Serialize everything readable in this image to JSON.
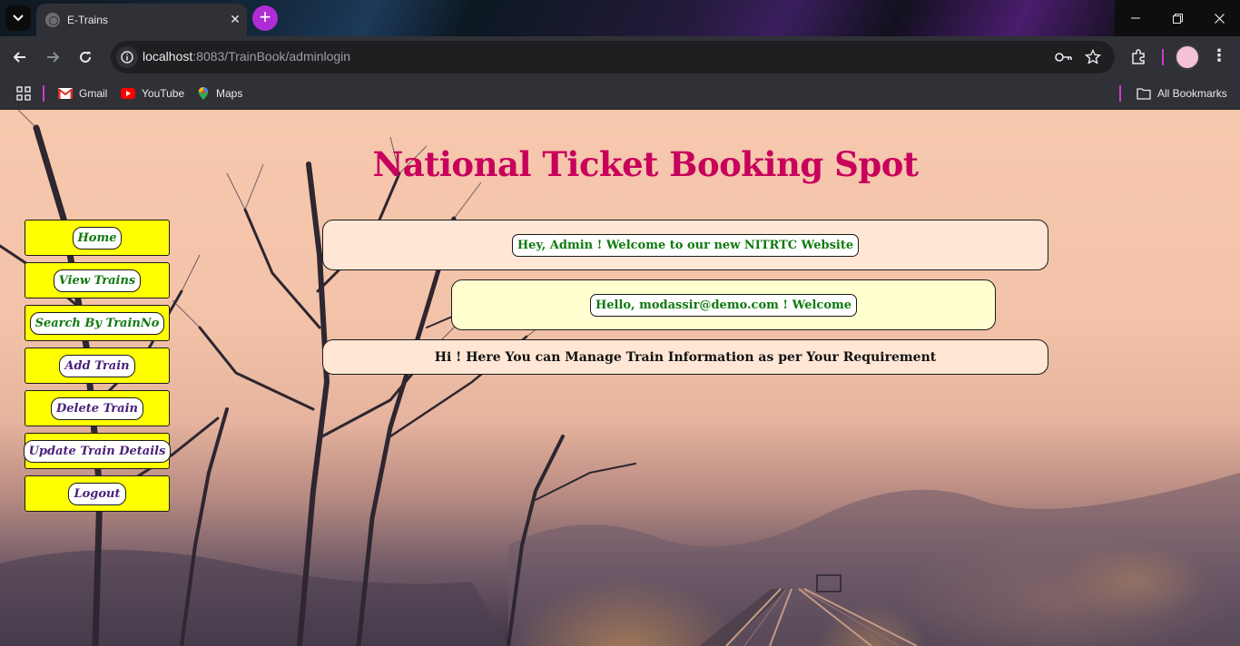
{
  "browser": {
    "tab_title": "E-Trains",
    "url_host": "localhost",
    "url_rest": ":8083/TrainBook/adminlogin",
    "bookmarks": [
      "Gmail",
      "YouTube",
      "Maps"
    ],
    "all_bookmarks": "All Bookmarks"
  },
  "page": {
    "title": "National Ticket Booking Spot",
    "nav": [
      {
        "label": "Home",
        "color": "#0f7a0f"
      },
      {
        "label": "View Trains",
        "color": "#0f7a0f"
      },
      {
        "label": "Search By TrainNo",
        "color": "#0f7a0f"
      },
      {
        "label": "Add Train",
        "color": "#4b1f7a"
      },
      {
        "label": "Delete Train",
        "color": "#4b1f7a"
      },
      {
        "label": "Update Train Details",
        "color": "#4b1f7a"
      },
      {
        "label": "Logout",
        "color": "#4b1f7a"
      }
    ],
    "messages": {
      "welcome_admin": "Hey, Admin ! Welcome to our new NITRTC Website",
      "welcome_user": "Hello, modassir@demo.com ! Welcome",
      "manage_info": "Hi ! Here You can Manage Train Information as per Your Requirement"
    }
  },
  "colors": {
    "title": "#c8005c",
    "nav_bg": "#ffff00",
    "message_box_1": "#ffe6d5",
    "message_box_2": "#ffffd0"
  }
}
